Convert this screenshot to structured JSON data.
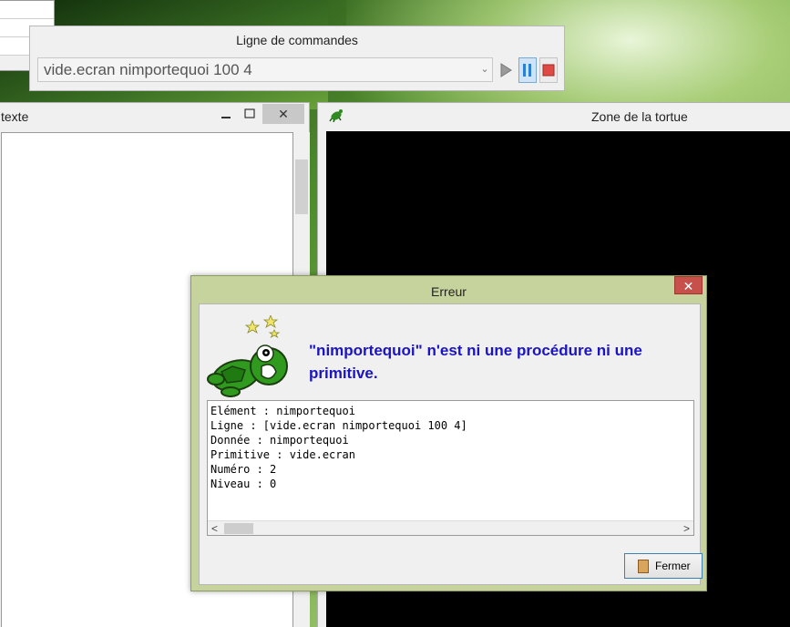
{
  "command_panel": {
    "title": "Ligne de commandes",
    "input_value": "vide.ecran nimportequoi 100 4"
  },
  "editor_panel": {
    "title": "texte"
  },
  "turtle_panel": {
    "title": "Zone de la tortue"
  },
  "dialog": {
    "title": "Erreur",
    "message": "\"nimportequoi\" n'est ni une procédure ni une primitive.",
    "details": "Elément : nimportequoi\nLigne : [vide.ecran nimportequoi 100 4]\nDonnée : nimportequoi\nPrimitive : vide.ecran\nNuméro : 2\nNiveau : 0",
    "close_label": "Fermer"
  },
  "colors": {
    "message": "#1a14c2",
    "dialog_frame": "#c7d39d",
    "close_x": "#c7504a"
  }
}
